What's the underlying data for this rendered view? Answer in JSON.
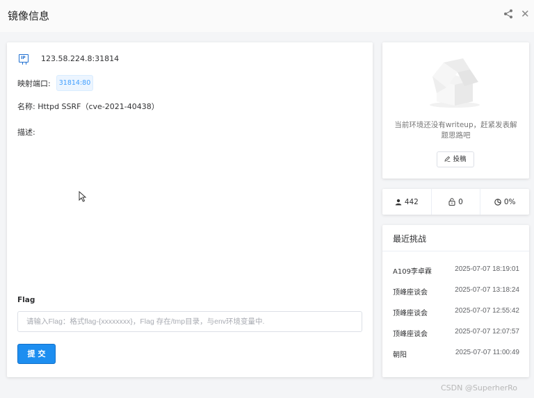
{
  "header": {
    "title": "镜像信息"
  },
  "main": {
    "ip_icon_text": "IP",
    "ip": "123.58.224.8:31814",
    "port_label": "映射端口:",
    "port_value": "31814:80",
    "name": "名称: Httpd SSRF（cve-2021-40438）",
    "desc_label": "描述:",
    "flag_label": "Flag",
    "flag_placeholder": "请输入Flag：格式flag-{xxxxxxxx}，Flag 存在/tmp目录，与env环境变量中.",
    "submit_label": "提交"
  },
  "writeup": {
    "message": "当前环境还没有writeup，赶紧发表解题思路吧",
    "button_label": "投稿"
  },
  "stats": {
    "users": "442",
    "locks": "0",
    "rate": "0%"
  },
  "recent": {
    "title": "最近挑战",
    "rows": [
      {
        "name": "A109李卓霖",
        "time": "2025-07-07 18:19:01"
      },
      {
        "name": "顶峰座谈会",
        "time": "2025-07-07 13:18:24"
      },
      {
        "name": "顶峰座谈会",
        "time": "2025-07-07 12:55:42"
      },
      {
        "name": "顶峰座谈会",
        "time": "2025-07-07 12:07:57"
      },
      {
        "name": "朝阳",
        "time": "2025-07-07 11:00:49"
      }
    ]
  },
  "watermark": "CSDN @SuperherRo",
  "colors": {
    "primary": "#1d8ef0",
    "tag_bg": "#ecf5ff",
    "tag_text": "#409eff"
  }
}
